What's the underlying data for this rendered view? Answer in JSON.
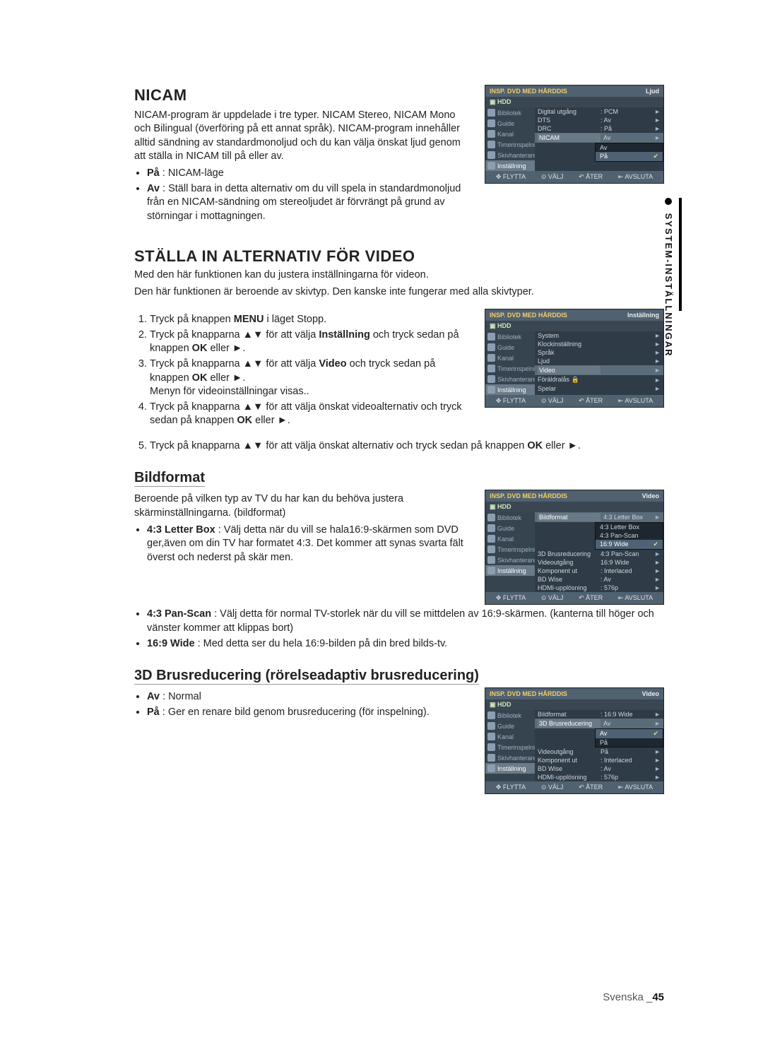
{
  "vtab": "SYSTEM-INSTÄLLNINGAR",
  "footer": {
    "lang": "Svenska",
    "sep": "_",
    "page": "45"
  },
  "nicam": {
    "heading": "NICAM",
    "intro": "NICAM-program är uppdelade i tre typer. NICAM Stereo, NICAM Mono och Bilingual (överföring på ett annat språk). NICAM-program innehåller alltid sändning av standardmonoljud och du kan välja önskat ljud genom att ställa in NICAM till på eller av.",
    "bul1_lead": "På",
    "bul1_rest": " : NICAM-läge",
    "bul2_lead": "Av",
    "bul2_rest": " : Ställ bara in detta alternativ om du vill spela in standardmonoljud från en NICAM-sändning om stereoljudet är förvrängt på grund av störningar i mottagningen."
  },
  "video": {
    "heading": "STÄLLA IN ALTERNATIV FÖR VIDEO",
    "p1": "Med den här funktionen kan du justera inställningarna för videon.",
    "p2": "Den här funktionen är beroende av skivtyp. Den kanske inte fungerar med alla skivtyper.",
    "step1_a": "Tryck på knappen ",
    "step1_b": "MENU",
    "step1_c": " i läget Stopp.",
    "step2_a": "Tryck på knapparna ▲▼ för att välja ",
    "step2_b": "Inställning",
    "step2_c": " och tryck sedan på knappen ",
    "step2_d": "OK",
    "step2_e": " eller ►.",
    "step3_a": "Tryck på knapparna ▲▼ för att välja ",
    "step3_b": "Video",
    "step3_c": " och tryck sedan på knappen ",
    "step3_d": "OK",
    "step3_e": " eller ►.",
    "step3_sub": "Menyn för videoinställningar visas..",
    "step4_a": "Tryck på knapparna ▲▼ för att välja önskat videoalternativ och tryck sedan på knappen ",
    "step4_b": "OK",
    "step4_c": " eller ►.",
    "step5_a": "Tryck på knapparna ▲▼ för att välja önskat alternativ och tryck sedan på knappen ",
    "step5_b": "OK",
    "step5_c": " eller ►."
  },
  "bildformat": {
    "heading": "Bildformat",
    "intro": "Beroende på vilken typ av TV du har kan du behöva justera skärminställningarna. (bildformat)",
    "b1_lead": "4:3 Letter Box",
    "b1_rest": " : Välj detta när du vill se hala16:9-skärmen som DVD ger,även om din TV har formatet 4:3. Det kommer att synas svarta fält överst och nederst på skär men.",
    "b2_lead": "4:3 Pan-Scan",
    "b2_rest": " : Välj detta för normal TV-storlek när du vill se mittdelen av 16:9-skärmen. (kanterna till höger och vänster kommer att klippas bort)",
    "b3_lead": "16:9 Wide",
    "b3_rest": " : Med detta ser du hela 16:9-bilden på din bred bilds-tv."
  },
  "brus": {
    "heading": "3D Brusreducering (rörelseadaptiv brusreducering)",
    "b1_lead": "Av",
    "b1_rest": " : Normal",
    "b2_lead": "På",
    "b2_rest": " : Ger en renare bild genom brusreducering (för inspelning)."
  },
  "osd_common": {
    "title": "INSP. DVD MED HÅRDDIS",
    "hdd": "HDD",
    "foot_flytta": "FLYTTA",
    "foot_valj": "VÄLJ",
    "foot_ater": "ÅTER",
    "foot_avsluta": "AVSLUTA",
    "side": [
      "Bibliotek",
      "Guide",
      "Kanal",
      "Timerinspelning",
      "Skivhanterare",
      "Inställning"
    ]
  },
  "osd1": {
    "mode": "Ljud",
    "rows": [
      {
        "label": "Digital utgång",
        "val": ": PCM"
      },
      {
        "label": "DTS",
        "val": ": Av"
      },
      {
        "label": "DRC",
        "val": ": På"
      },
      {
        "label": "NICAM",
        "val": "Av",
        "sel": true
      }
    ],
    "popup": [
      {
        "label": "Av"
      },
      {
        "label": "På",
        "chk": true
      }
    ]
  },
  "osd2": {
    "mode": "Inställning",
    "rows": [
      {
        "label": "System"
      },
      {
        "label": "Klockinställning"
      },
      {
        "label": "Språk"
      },
      {
        "label": "Ljud"
      },
      {
        "label": "Video",
        "sel": true
      },
      {
        "label": "Föräldralås 🔒"
      },
      {
        "label": "Spelar"
      }
    ]
  },
  "osd3": {
    "mode": "Video",
    "rows": [
      {
        "label": "Bildformat",
        "val": "4:3 Letter Box",
        "sel": true
      },
      {
        "label": "3D Brusreducering",
        "val": "4:3 Pan-Scan"
      },
      {
        "label": "Videoutgång",
        "val": "16:9 Wide",
        "chk": true
      },
      {
        "label": "Komponent ut",
        "val": ": Interlaced"
      },
      {
        "label": "BD Wise",
        "val": ": Av"
      },
      {
        "label": "HDMI-upplösning",
        "val": ": 576p"
      }
    ],
    "popup": [
      "4:3 Letter Box",
      "4:3 Pan-Scan",
      "16:9 Wide"
    ],
    "popup_chk_index": 2
  },
  "osd4": {
    "mode": "Video",
    "rows": [
      {
        "label": "Bildformat",
        "val": ": 16:9 Wide"
      },
      {
        "label": "3D Brusreducering",
        "val": "Av",
        "sel": true
      },
      {
        "label": "Videoutgång",
        "val": "På"
      },
      {
        "label": "Komponent ut",
        "val": ": Interlaced"
      },
      {
        "label": "BD Wise",
        "val": ": Av"
      },
      {
        "label": "HDMI-upplösning",
        "val": ": 576p"
      }
    ],
    "popup": [
      "Av",
      "På"
    ],
    "popup_chk_index": 0
  }
}
